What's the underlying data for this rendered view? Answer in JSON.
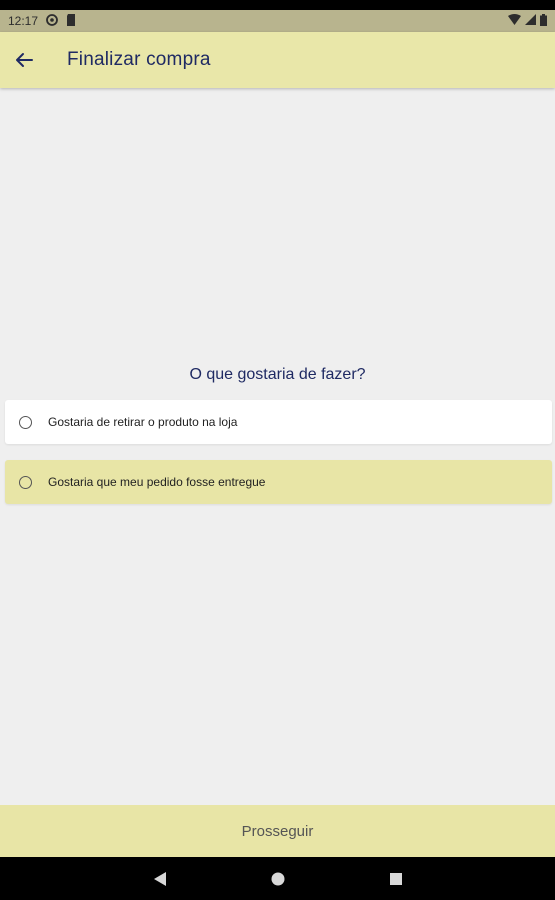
{
  "status_bar": {
    "time": "12:17"
  },
  "app_bar": {
    "title": "Finalizar compra"
  },
  "question": "O que gostaria de fazer?",
  "options": [
    {
      "label": "Gostaria de retirar o produto na loja"
    },
    {
      "label": "Gostaria que meu pedido fosse entregue"
    }
  ],
  "bottom_button": {
    "label": "Prosseguir"
  },
  "icons": {
    "back": "arrow-left-icon",
    "nav_back": "back-triangle-icon",
    "nav_home": "home-circle-icon",
    "nav_recents": "recents-square-icon"
  },
  "colors": {
    "app_bar": "#e9e7a9",
    "status_bar": "#b8b48e",
    "highlight_option": "#e8e5a6",
    "title_text": "#1f2a63",
    "background": "#efefef"
  }
}
